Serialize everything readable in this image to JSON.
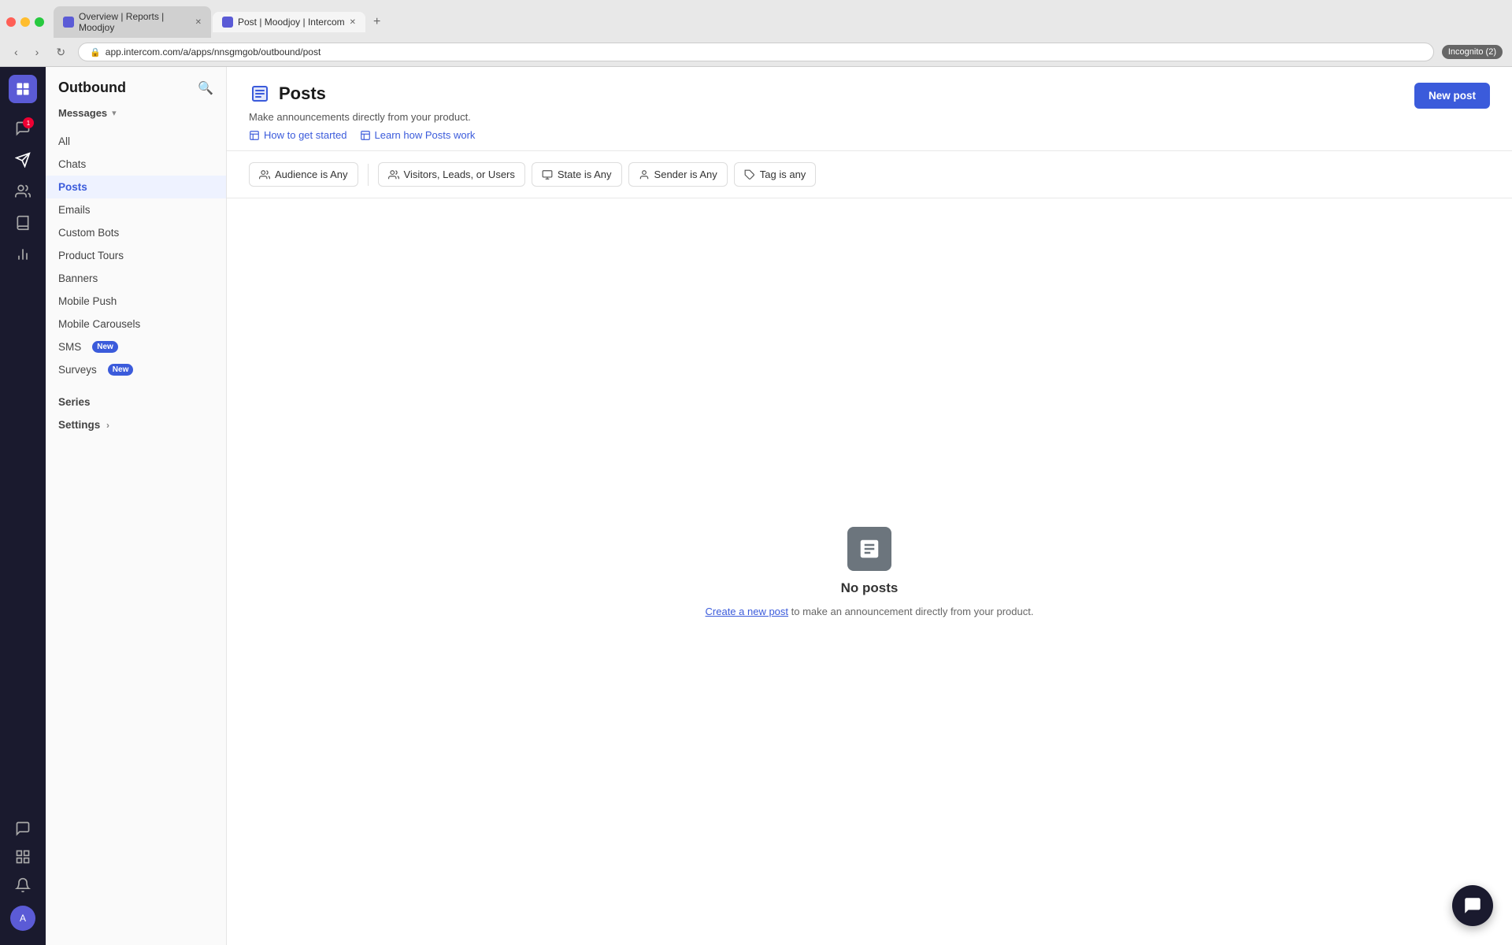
{
  "browser": {
    "tabs": [
      {
        "id": "tab1",
        "label": "Overview | Reports | Moodjoy",
        "active": false
      },
      {
        "id": "tab2",
        "label": "Post | Moodjoy | Intercom",
        "active": true
      }
    ],
    "url": "app.intercom.com/a/apps/nnsgmgob/outbound/post",
    "incognito_label": "Incognito (2)"
  },
  "sidebar": {
    "title": "Outbound",
    "messages_label": "Messages",
    "nav_items": [
      {
        "id": "all",
        "label": "All",
        "active": false
      },
      {
        "id": "chats",
        "label": "Chats",
        "active": false
      },
      {
        "id": "posts",
        "label": "Posts",
        "active": true
      },
      {
        "id": "emails",
        "label": "Emails",
        "active": false
      },
      {
        "id": "custom-bots",
        "label": "Custom Bots",
        "active": false
      },
      {
        "id": "product-tours",
        "label": "Product Tours",
        "active": false
      },
      {
        "id": "banners",
        "label": "Banners",
        "active": false
      },
      {
        "id": "mobile-push",
        "label": "Mobile Push",
        "active": false
      },
      {
        "id": "mobile-carousels",
        "label": "Mobile Carousels",
        "active": false
      },
      {
        "id": "sms",
        "label": "SMS",
        "badge": "New",
        "active": false
      },
      {
        "id": "surveys",
        "label": "Surveys",
        "badge": "New",
        "active": false
      }
    ],
    "series_label": "Series",
    "settings_label": "Settings"
  },
  "main": {
    "page_title": "Posts",
    "page_description": "Make announcements directly from your product.",
    "link_get_started": "How to get started",
    "link_learn": "Learn how Posts work",
    "new_post_label": "New post"
  },
  "filters": [
    {
      "id": "audience",
      "icon": "audience-icon",
      "label": "Audience is Any"
    },
    {
      "id": "visitors",
      "icon": "visitors-icon",
      "label": "Visitors, Leads, or Users"
    },
    {
      "id": "state",
      "icon": "state-icon",
      "label": "State is Any"
    },
    {
      "id": "sender",
      "icon": "sender-icon",
      "label": "Sender is  Any"
    },
    {
      "id": "tag",
      "icon": "tag-icon",
      "label": "Tag is any"
    }
  ],
  "empty_state": {
    "title": "No posts",
    "description_prefix": "",
    "link_text": "Create a new post",
    "description_suffix": " to make an announcement directly from your product."
  }
}
